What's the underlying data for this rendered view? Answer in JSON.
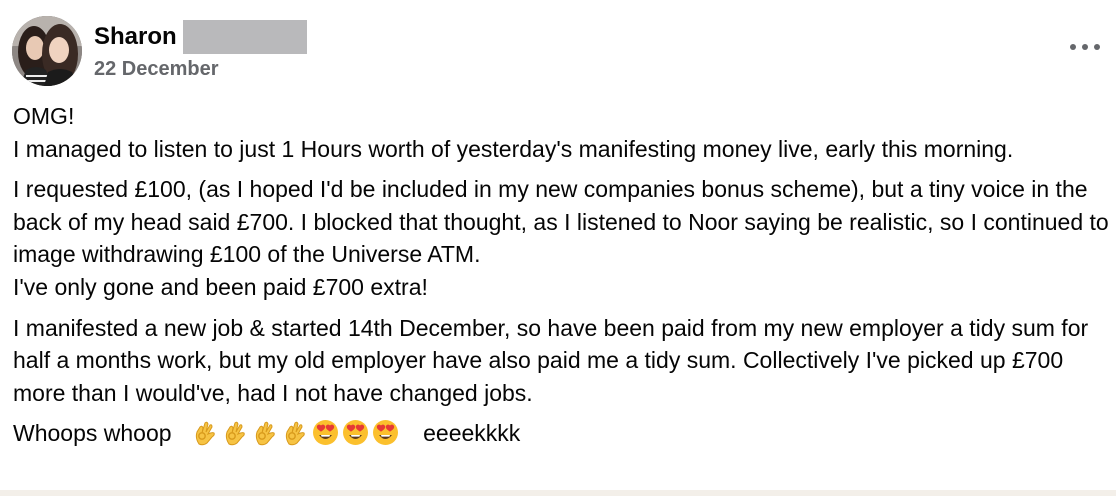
{
  "post": {
    "author": "Sharon",
    "date": "22 December",
    "more_icon": "more-horizontal-icon",
    "paragraphs": [
      {
        "lines": [
          "OMG!",
          "I managed to listen to just 1 Hours worth of yesterday's manifesting money live, early this morning."
        ]
      },
      {
        "lines": [
          "I requested £100, (as I hoped I'd be included in my new companies bonus scheme), but a tiny voice in the back of my head said £700.  I blocked that thought, as I listened to Noor saying be realistic, so I continued to image withdrawing £100 of the Universe ATM.",
          "I've only gone and been paid £700 extra!"
        ]
      },
      {
        "lines": [
          "I manifested a new job & started 14th December, so have been paid from my new employer a tidy sum for half a months work, but my old employer have also paid me a tidy sum. Collectively I've picked up £700 more than I would've, had I not have changed jobs."
        ]
      }
    ],
    "closing": {
      "before": "Whoops whoop",
      "emojis": [
        "ok-hand-emoji",
        "ok-hand-emoji",
        "ok-hand-emoji",
        "ok-hand-emoji",
        "heart-eyes-emoji",
        "heart-eyes-emoji",
        "heart-eyes-emoji"
      ],
      "after": "eeeekkkk"
    }
  },
  "colors": {
    "text": "#050505",
    "secondary": "#65676b",
    "redaction": "#b9b9bb"
  }
}
